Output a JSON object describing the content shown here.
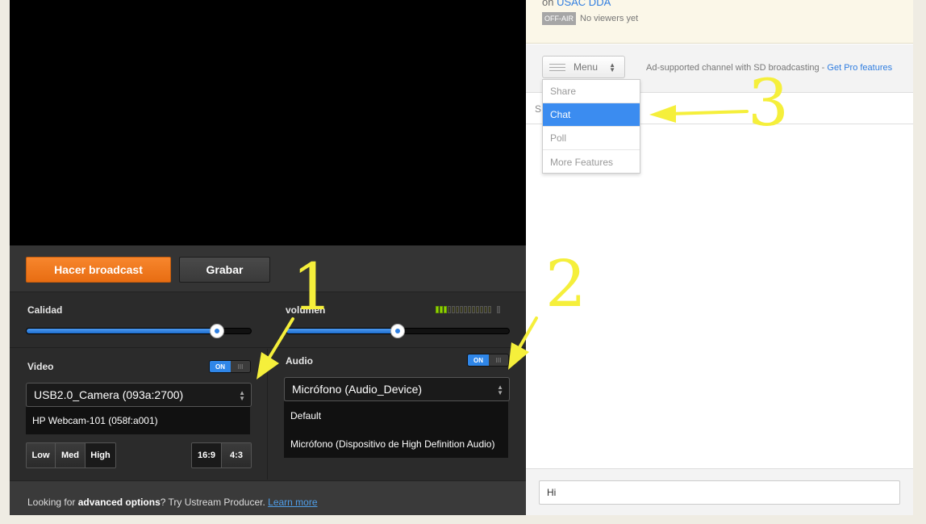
{
  "broadcast": {
    "broadcast_button": "Hacer broadcast",
    "record_button": "Grabar"
  },
  "sliders": {
    "quality_label": "Calidad",
    "quality_value": 0.85,
    "volume_label": "volumen",
    "volume_value": 0.5,
    "vu_level": 3
  },
  "video": {
    "label": "Video",
    "toggle_on": "ON",
    "toggle_off": "III",
    "selected": "USB2.0_Camera (093a:2700)",
    "options": [
      "HP Webcam-101 (058f:a001)"
    ],
    "quality_buttons": [
      "Low",
      "Med",
      "High"
    ],
    "aspect_buttons": [
      "16:9",
      "4:3"
    ]
  },
  "audio": {
    "label": "Audio",
    "toggle_on": "ON",
    "toggle_off": "III",
    "selected": "Micrófono (Audio_Device)",
    "options": [
      "Default",
      "Micrófono (Dispositivo de High Definition Audio)"
    ]
  },
  "footer": {
    "prefix": "Looking for ",
    "bold": "advanced options",
    "middle": "? Try Ustream Producer. ",
    "link": "Learn more"
  },
  "channel": {
    "on_prefix": "on ",
    "name": "USAC DDA",
    "status_badge": "OFF-AIR",
    "viewers": "No viewers yet"
  },
  "toolbar": {
    "menu_label": "Menu",
    "ad_text": "Ad-supported channel with SD broadcasting - ",
    "pro_link": "Get Pro features"
  },
  "menu": {
    "items": [
      "Share",
      "Chat",
      "Poll",
      "More Features"
    ],
    "selected_index": 1
  },
  "tab_partial": "S",
  "chat": {
    "input_value": "Hi"
  },
  "annotations": [
    "1",
    "2",
    "3"
  ],
  "colors": {
    "accent_orange": "#f07c22",
    "accent_blue": "#2f86e8",
    "annotation_yellow": "#f5ef3b"
  }
}
